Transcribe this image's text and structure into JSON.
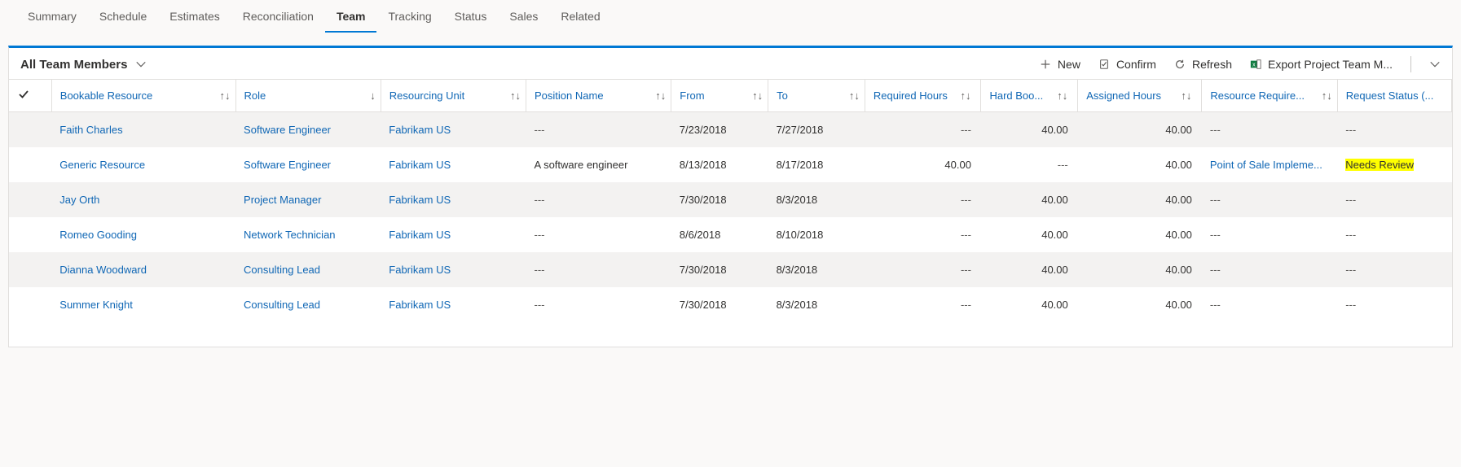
{
  "tabs": [
    {
      "label": "Summary"
    },
    {
      "label": "Schedule"
    },
    {
      "label": "Estimates"
    },
    {
      "label": "Reconciliation"
    },
    {
      "label": "Team",
      "active": true
    },
    {
      "label": "Tracking"
    },
    {
      "label": "Status"
    },
    {
      "label": "Sales"
    },
    {
      "label": "Related"
    }
  ],
  "view_title": "All Team Members",
  "toolbar": {
    "new": "New",
    "confirm": "Confirm",
    "refresh": "Refresh",
    "export": "Export Project Team M..."
  },
  "columns": {
    "bookable_resource": "Bookable Resource",
    "role": "Role",
    "resourcing_unit": "Resourcing Unit",
    "position_name": "Position Name",
    "from": "From",
    "to": "To",
    "required_hours": "Required Hours",
    "hard_book": "Hard Boo...",
    "assigned_hours": "Assigned Hours",
    "resource_requirement": "Resource Require...",
    "request_status": "Request Status (..."
  },
  "rows": [
    {
      "resource": "Faith Charles",
      "role": "Software Engineer",
      "unit": "Fabrikam US",
      "position": "---",
      "from": "7/23/2018",
      "to": "7/27/2018",
      "required": "---",
      "hard": "40.00",
      "assigned": "40.00",
      "req": "---",
      "status": "---"
    },
    {
      "resource": "Generic Resource",
      "role": "Software Engineer",
      "unit": "Fabrikam US",
      "position": "A software engineer",
      "from": "8/13/2018",
      "to": "8/17/2018",
      "required": "40.00",
      "hard": "---",
      "assigned": "40.00",
      "req": "Point of Sale Impleme...",
      "status": "Needs Review",
      "highlight": true
    },
    {
      "resource": "Jay Orth",
      "role": "Project Manager",
      "unit": "Fabrikam US",
      "position": "---",
      "from": "7/30/2018",
      "to": "8/3/2018",
      "required": "---",
      "hard": "40.00",
      "assigned": "40.00",
      "req": "---",
      "status": "---"
    },
    {
      "resource": "Romeo Gooding",
      "role": "Network Technician",
      "unit": "Fabrikam US",
      "position": "---",
      "from": "8/6/2018",
      "to": "8/10/2018",
      "required": "---",
      "hard": "40.00",
      "assigned": "40.00",
      "req": "---",
      "status": "---"
    },
    {
      "resource": "Dianna Woodward",
      "role": "Consulting Lead",
      "unit": "Fabrikam US",
      "position": "---",
      "from": "7/30/2018",
      "to": "8/3/2018",
      "required": "---",
      "hard": "40.00",
      "assigned": "40.00",
      "req": "---",
      "status": "---"
    },
    {
      "resource": "Summer Knight",
      "role": "Consulting Lead",
      "unit": "Fabrikam US",
      "position": "---",
      "from": "7/30/2018",
      "to": "8/3/2018",
      "required": "---",
      "hard": "40.00",
      "assigned": "40.00",
      "req": "---",
      "status": "---"
    }
  ]
}
